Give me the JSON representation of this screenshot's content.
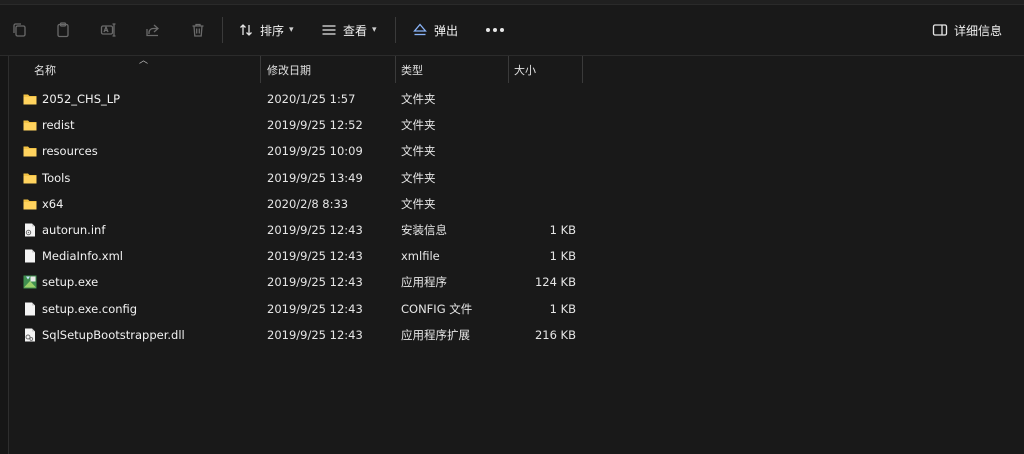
{
  "toolbar": {
    "sort_label": "排序",
    "view_label": "查看",
    "eject_label": "弹出",
    "details_label": "详细信息",
    "chevron": "⌄"
  },
  "columns": {
    "name": "名称",
    "date": "修改日期",
    "type": "类型",
    "size": "大小"
  },
  "files": [
    {
      "name": "2052_CHS_LP",
      "date": "2020/1/25 1:57",
      "type": "文件夹",
      "size": "",
      "icon": "folder-icon"
    },
    {
      "name": "redist",
      "date": "2019/9/25 12:52",
      "type": "文件夹",
      "size": "",
      "icon": "folder-icon"
    },
    {
      "name": "resources",
      "date": "2019/9/25 10:09",
      "type": "文件夹",
      "size": "",
      "icon": "folder-icon"
    },
    {
      "name": "Tools",
      "date": "2019/9/25 13:49",
      "type": "文件夹",
      "size": "",
      "icon": "folder-icon"
    },
    {
      "name": "x64",
      "date": "2020/2/8 8:33",
      "type": "文件夹",
      "size": "",
      "icon": "folder-icon"
    },
    {
      "name": "autorun.inf",
      "date": "2019/9/25 12:43",
      "type": "安装信息",
      "size": "1 KB",
      "icon": "settings-file-icon"
    },
    {
      "name": "MediaInfo.xml",
      "date": "2019/9/25 12:43",
      "type": "xmlfile",
      "size": "1 KB",
      "icon": "document-icon"
    },
    {
      "name": "setup.exe",
      "date": "2019/9/25 12:43",
      "type": "应用程序",
      "size": "124 KB",
      "icon": "installer-icon"
    },
    {
      "name": "setup.exe.config",
      "date": "2019/9/25 12:43",
      "type": "CONFIG 文件",
      "size": "1 KB",
      "icon": "document-icon"
    },
    {
      "name": "SqlSetupBootstrapper.dll",
      "date": "2019/9/25 12:43",
      "type": "应用程序扩展",
      "size": "216 KB",
      "icon": "dll-file-icon"
    }
  ],
  "colors": {
    "background": "#191919",
    "folder": "#f2c244",
    "text": "#f2f2f2",
    "eject_accent": "#8ab4f8"
  }
}
